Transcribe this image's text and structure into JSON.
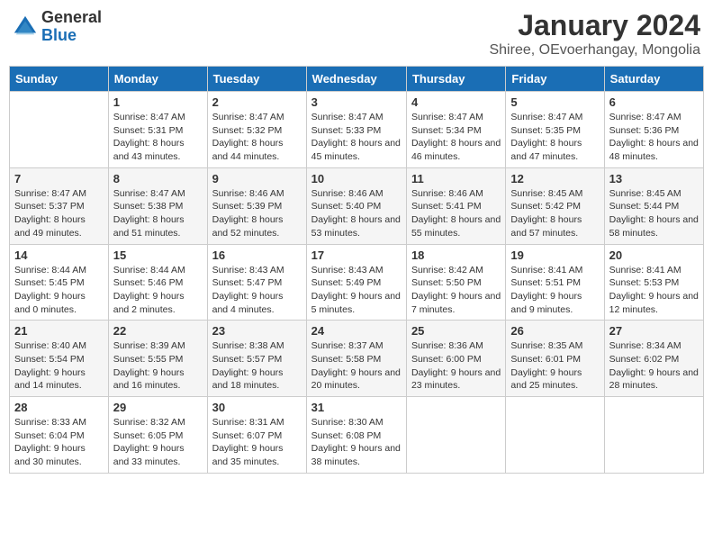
{
  "header": {
    "logo_general": "General",
    "logo_blue": "Blue",
    "month_title": "January 2024",
    "location": "Shiree, OEvoerhangay, Mongolia"
  },
  "weekdays": [
    "Sunday",
    "Monday",
    "Tuesday",
    "Wednesday",
    "Thursday",
    "Friday",
    "Saturday"
  ],
  "weeks": [
    [
      {
        "day": "",
        "sunrise": "",
        "sunset": "",
        "daylight": ""
      },
      {
        "day": "1",
        "sunrise": "Sunrise: 8:47 AM",
        "sunset": "Sunset: 5:31 PM",
        "daylight": "Daylight: 8 hours and 43 minutes."
      },
      {
        "day": "2",
        "sunrise": "Sunrise: 8:47 AM",
        "sunset": "Sunset: 5:32 PM",
        "daylight": "Daylight: 8 hours and 44 minutes."
      },
      {
        "day": "3",
        "sunrise": "Sunrise: 8:47 AM",
        "sunset": "Sunset: 5:33 PM",
        "daylight": "Daylight: 8 hours and 45 minutes."
      },
      {
        "day": "4",
        "sunrise": "Sunrise: 8:47 AM",
        "sunset": "Sunset: 5:34 PM",
        "daylight": "Daylight: 8 hours and 46 minutes."
      },
      {
        "day": "5",
        "sunrise": "Sunrise: 8:47 AM",
        "sunset": "Sunset: 5:35 PM",
        "daylight": "Daylight: 8 hours and 47 minutes."
      },
      {
        "day": "6",
        "sunrise": "Sunrise: 8:47 AM",
        "sunset": "Sunset: 5:36 PM",
        "daylight": "Daylight: 8 hours and 48 minutes."
      }
    ],
    [
      {
        "day": "7",
        "sunrise": "Sunrise: 8:47 AM",
        "sunset": "Sunset: 5:37 PM",
        "daylight": "Daylight: 8 hours and 49 minutes."
      },
      {
        "day": "8",
        "sunrise": "Sunrise: 8:47 AM",
        "sunset": "Sunset: 5:38 PM",
        "daylight": "Daylight: 8 hours and 51 minutes."
      },
      {
        "day": "9",
        "sunrise": "Sunrise: 8:46 AM",
        "sunset": "Sunset: 5:39 PM",
        "daylight": "Daylight: 8 hours and 52 minutes."
      },
      {
        "day": "10",
        "sunrise": "Sunrise: 8:46 AM",
        "sunset": "Sunset: 5:40 PM",
        "daylight": "Daylight: 8 hours and 53 minutes."
      },
      {
        "day": "11",
        "sunrise": "Sunrise: 8:46 AM",
        "sunset": "Sunset: 5:41 PM",
        "daylight": "Daylight: 8 hours and 55 minutes."
      },
      {
        "day": "12",
        "sunrise": "Sunrise: 8:45 AM",
        "sunset": "Sunset: 5:42 PM",
        "daylight": "Daylight: 8 hours and 57 minutes."
      },
      {
        "day": "13",
        "sunrise": "Sunrise: 8:45 AM",
        "sunset": "Sunset: 5:44 PM",
        "daylight": "Daylight: 8 hours and 58 minutes."
      }
    ],
    [
      {
        "day": "14",
        "sunrise": "Sunrise: 8:44 AM",
        "sunset": "Sunset: 5:45 PM",
        "daylight": "Daylight: 9 hours and 0 minutes."
      },
      {
        "day": "15",
        "sunrise": "Sunrise: 8:44 AM",
        "sunset": "Sunset: 5:46 PM",
        "daylight": "Daylight: 9 hours and 2 minutes."
      },
      {
        "day": "16",
        "sunrise": "Sunrise: 8:43 AM",
        "sunset": "Sunset: 5:47 PM",
        "daylight": "Daylight: 9 hours and 4 minutes."
      },
      {
        "day": "17",
        "sunrise": "Sunrise: 8:43 AM",
        "sunset": "Sunset: 5:49 PM",
        "daylight": "Daylight: 9 hours and 5 minutes."
      },
      {
        "day": "18",
        "sunrise": "Sunrise: 8:42 AM",
        "sunset": "Sunset: 5:50 PM",
        "daylight": "Daylight: 9 hours and 7 minutes."
      },
      {
        "day": "19",
        "sunrise": "Sunrise: 8:41 AM",
        "sunset": "Sunset: 5:51 PM",
        "daylight": "Daylight: 9 hours and 9 minutes."
      },
      {
        "day": "20",
        "sunrise": "Sunrise: 8:41 AM",
        "sunset": "Sunset: 5:53 PM",
        "daylight": "Daylight: 9 hours and 12 minutes."
      }
    ],
    [
      {
        "day": "21",
        "sunrise": "Sunrise: 8:40 AM",
        "sunset": "Sunset: 5:54 PM",
        "daylight": "Daylight: 9 hours and 14 minutes."
      },
      {
        "day": "22",
        "sunrise": "Sunrise: 8:39 AM",
        "sunset": "Sunset: 5:55 PM",
        "daylight": "Daylight: 9 hours and 16 minutes."
      },
      {
        "day": "23",
        "sunrise": "Sunrise: 8:38 AM",
        "sunset": "Sunset: 5:57 PM",
        "daylight": "Daylight: 9 hours and 18 minutes."
      },
      {
        "day": "24",
        "sunrise": "Sunrise: 8:37 AM",
        "sunset": "Sunset: 5:58 PM",
        "daylight": "Daylight: 9 hours and 20 minutes."
      },
      {
        "day": "25",
        "sunrise": "Sunrise: 8:36 AM",
        "sunset": "Sunset: 6:00 PM",
        "daylight": "Daylight: 9 hours and 23 minutes."
      },
      {
        "day": "26",
        "sunrise": "Sunrise: 8:35 AM",
        "sunset": "Sunset: 6:01 PM",
        "daylight": "Daylight: 9 hours and 25 minutes."
      },
      {
        "day": "27",
        "sunrise": "Sunrise: 8:34 AM",
        "sunset": "Sunset: 6:02 PM",
        "daylight": "Daylight: 9 hours and 28 minutes."
      }
    ],
    [
      {
        "day": "28",
        "sunrise": "Sunrise: 8:33 AM",
        "sunset": "Sunset: 6:04 PM",
        "daylight": "Daylight: 9 hours and 30 minutes."
      },
      {
        "day": "29",
        "sunrise": "Sunrise: 8:32 AM",
        "sunset": "Sunset: 6:05 PM",
        "daylight": "Daylight: 9 hours and 33 minutes."
      },
      {
        "day": "30",
        "sunrise": "Sunrise: 8:31 AM",
        "sunset": "Sunset: 6:07 PM",
        "daylight": "Daylight: 9 hours and 35 minutes."
      },
      {
        "day": "31",
        "sunrise": "Sunrise: 8:30 AM",
        "sunset": "Sunset: 6:08 PM",
        "daylight": "Daylight: 9 hours and 38 minutes."
      },
      {
        "day": "",
        "sunrise": "",
        "sunset": "",
        "daylight": ""
      },
      {
        "day": "",
        "sunrise": "",
        "sunset": "",
        "daylight": ""
      },
      {
        "day": "",
        "sunrise": "",
        "sunset": "",
        "daylight": ""
      }
    ]
  ]
}
